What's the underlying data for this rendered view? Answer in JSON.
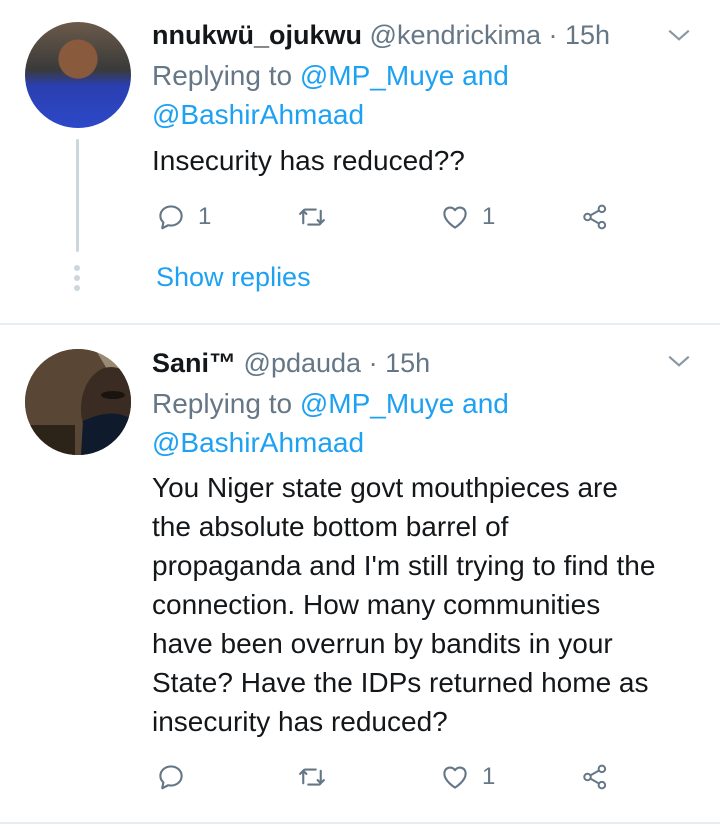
{
  "tweets": [
    {
      "name": "nnukwü_ojukwu",
      "handle": "@kendrickima",
      "sep": "·",
      "time": "15h",
      "replying_prefix": "Replying to ",
      "replying_1": "@MP_Muye",
      "replying_and": " and",
      "replying_2": "@BashirAhmaad",
      "text": "Insecurity has reduced??",
      "reply_count": "1",
      "retweet_count": "",
      "like_count": "1",
      "show_replies": "Show replies"
    },
    {
      "name": "Sani™",
      "handle": "@pdauda",
      "sep": "·",
      "time": "15h",
      "replying_prefix": "Replying to ",
      "replying_1": "@MP_Muye",
      "replying_and": " and",
      "replying_2": "@BashirAhmaad",
      "text_lines": [
        "You Niger state govt mouthpieces are",
        "the absolute bottom barrel of",
        "propaganda and I'm still trying to find the",
        "connection. How many communities",
        "have been overrun by bandits in your",
        "State? Have the IDPs returned home as",
        "insecurity has reduced?"
      ],
      "reply_count": "",
      "retweet_count": "",
      "like_count": "1"
    }
  ],
  "icons": {
    "reply": "reply-icon",
    "retweet": "retweet-icon",
    "like": "heart-icon",
    "share": "share-icon",
    "menu": "chevron-down-icon"
  },
  "colors": {
    "accent": "#1da1f2",
    "muted": "#657786",
    "text": "#14171a",
    "divider": "#e6ecf0"
  }
}
